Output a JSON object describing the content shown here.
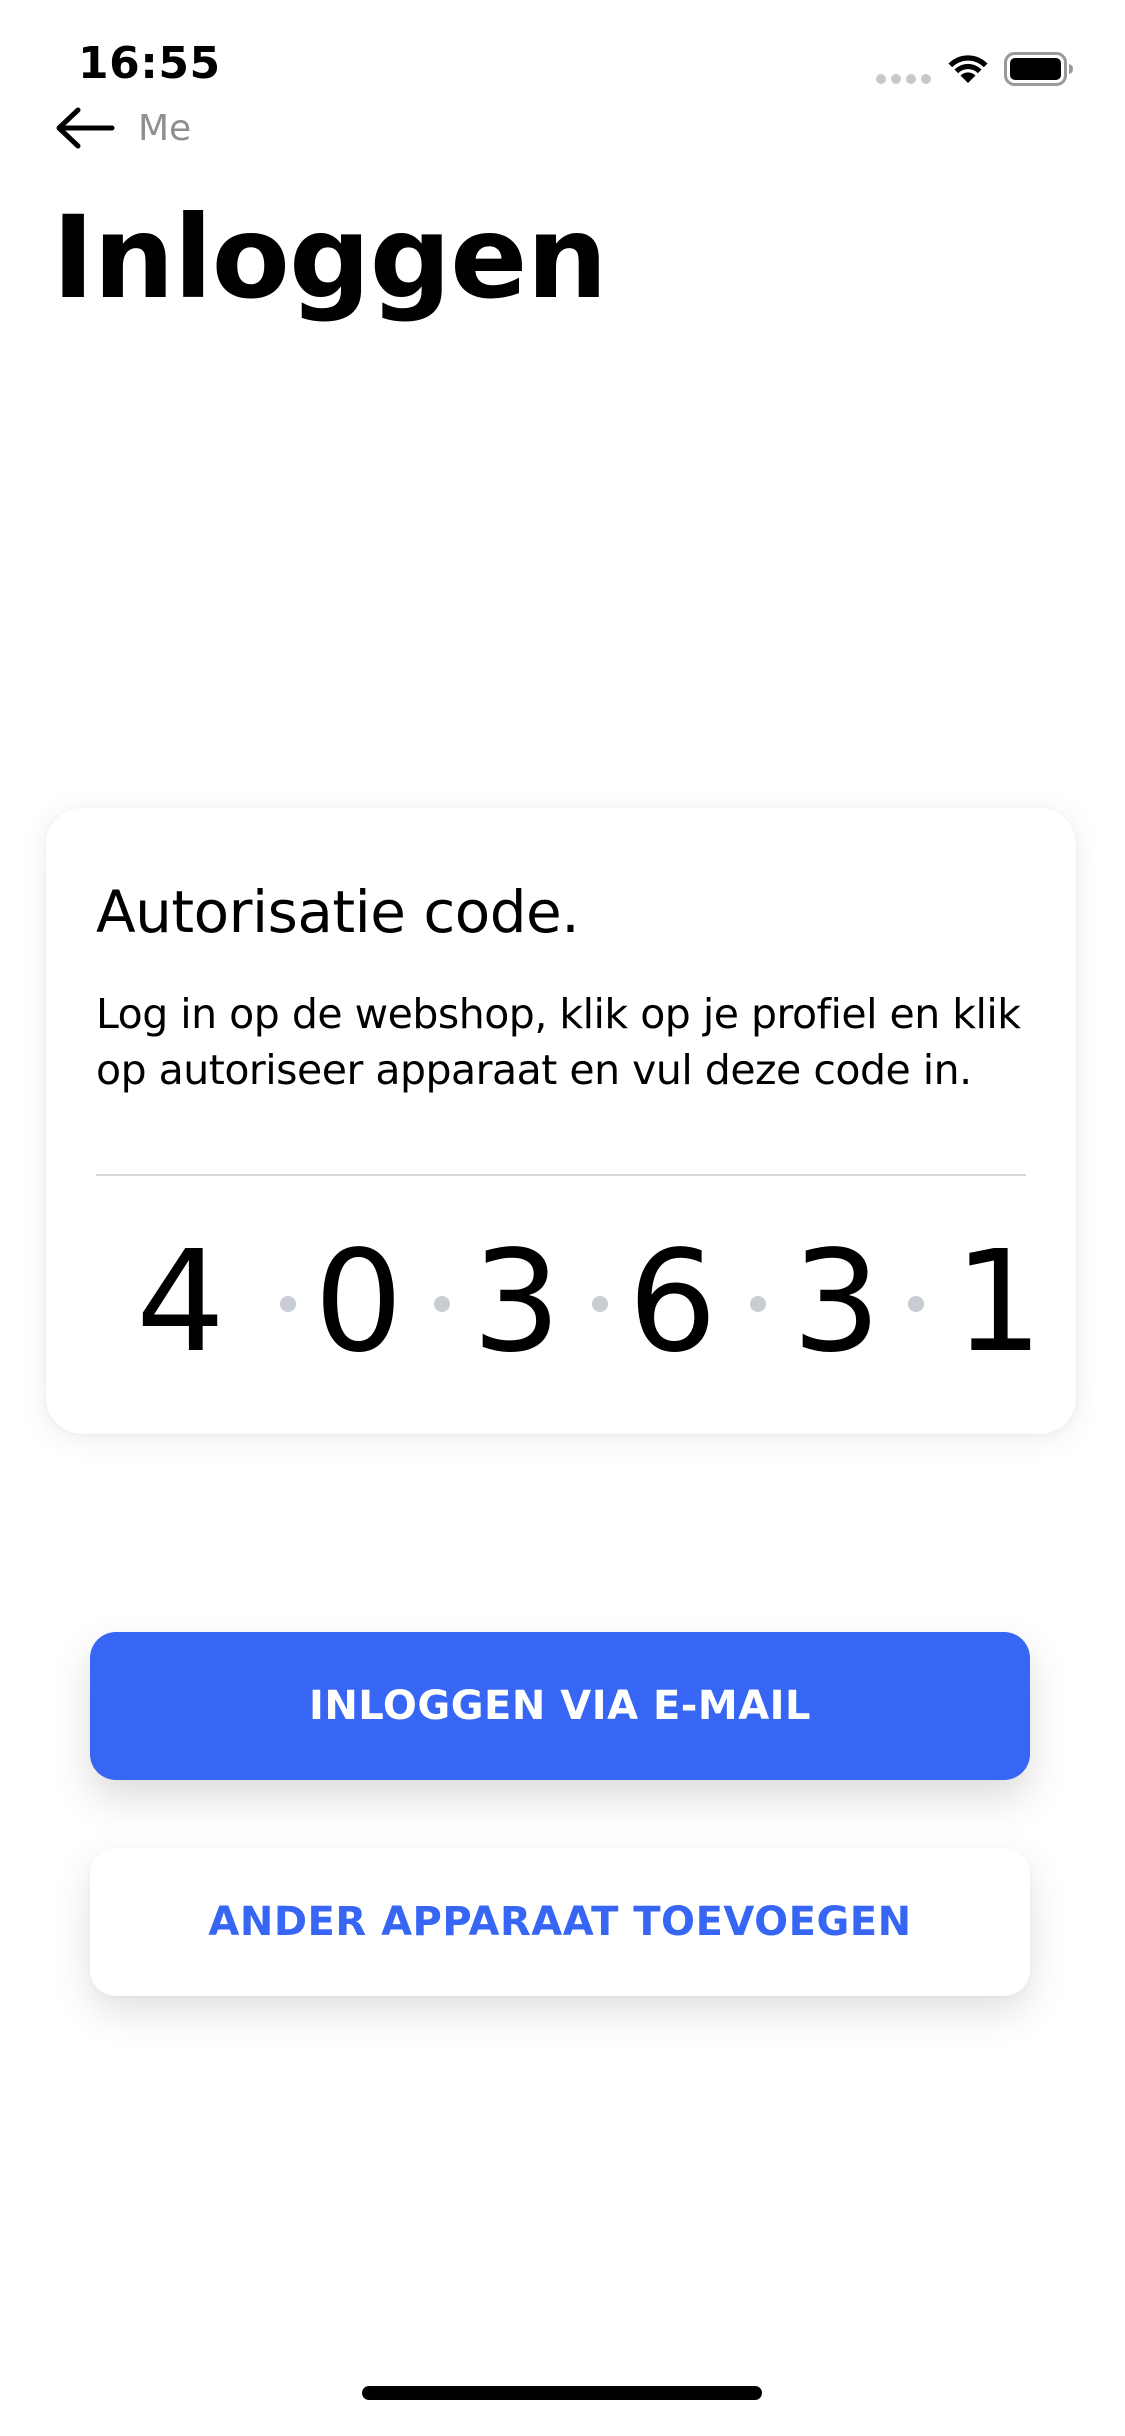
{
  "status_bar": {
    "time": "16:55",
    "icons": [
      "signal-icon",
      "wifi-icon",
      "battery-icon"
    ]
  },
  "nav": {
    "back_label": "Me",
    "back_icon": "arrow-left-icon"
  },
  "page": {
    "title": "Inloggen"
  },
  "auth_card": {
    "title": "Autorisatie code.",
    "description": "Log in op de webshop, klik op je profiel en klik op autoriseer apparaat en vul deze code in.",
    "code_digits": [
      "4",
      "0",
      "3",
      "6",
      "3",
      "1"
    ]
  },
  "actions": {
    "email_login_label": "INLOGGEN VIA E-MAIL",
    "add_device_label": "ANDER APPARAAT TOEVOEGEN"
  },
  "colors": {
    "accent": "#3766f4",
    "background": "#ffffff",
    "muted_text": "#8e8e93",
    "separator_dot": "#c8ccd3"
  }
}
